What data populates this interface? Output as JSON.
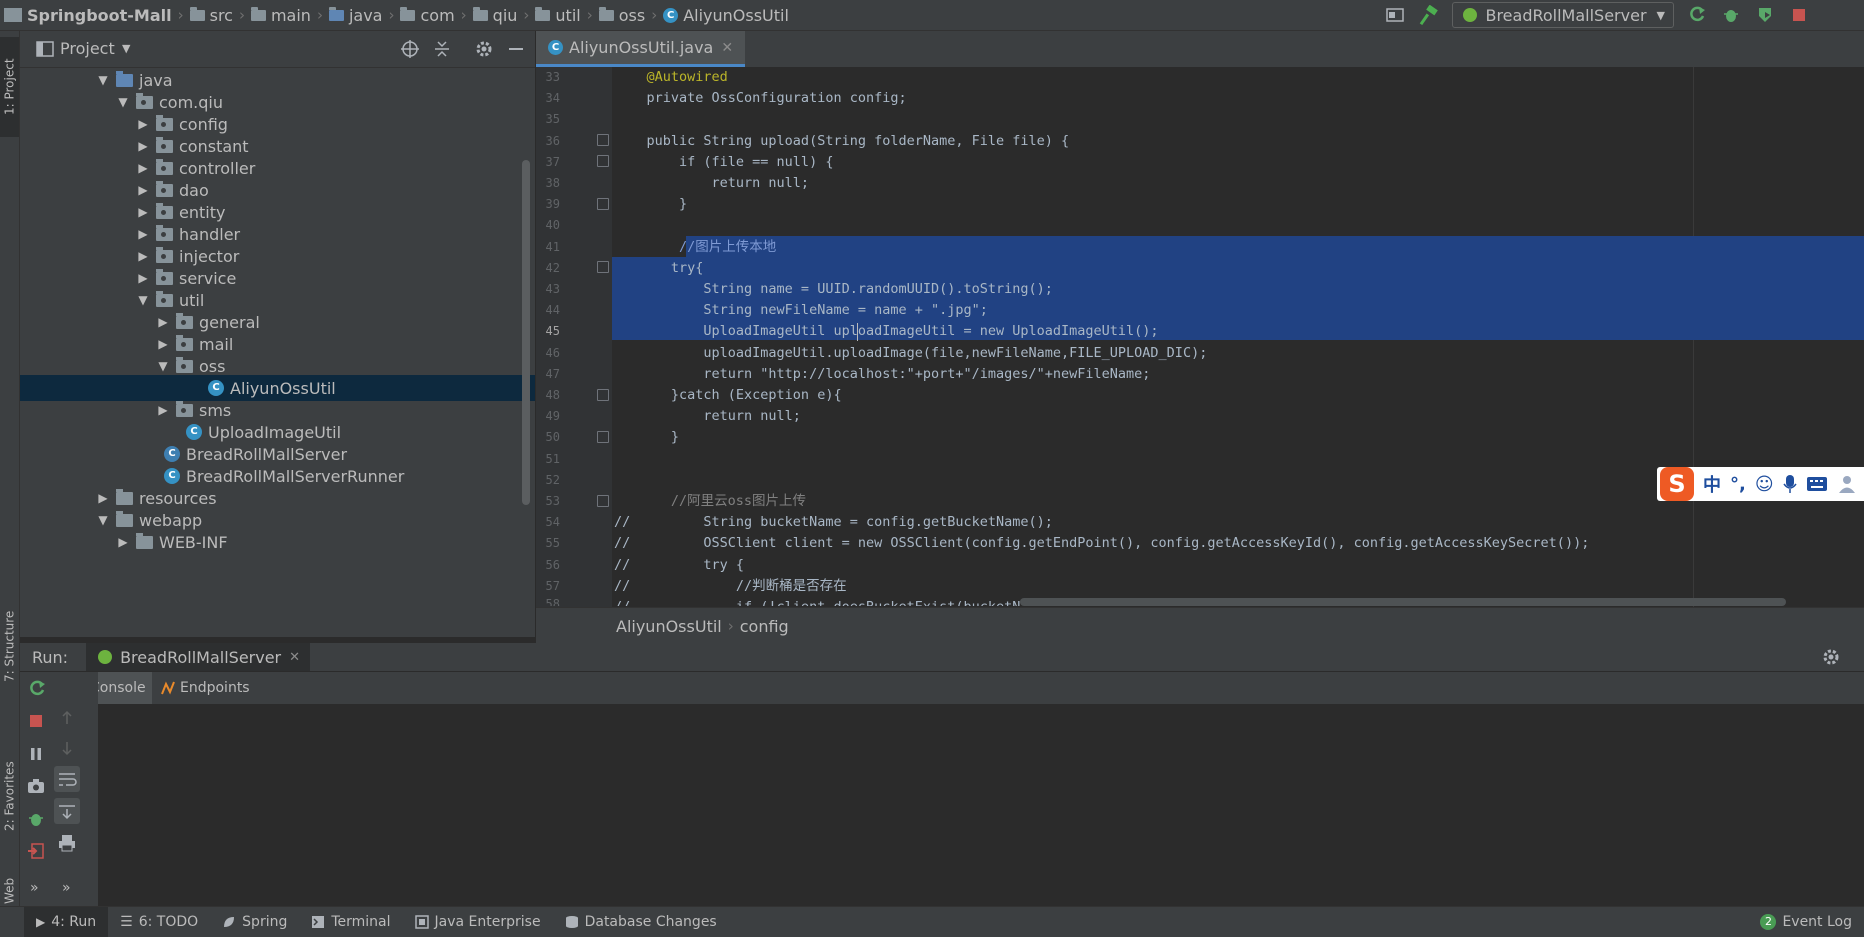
{
  "breadcrumbs": [
    "Springboot-Mall",
    "src",
    "main",
    "java",
    "com",
    "qiu",
    "util",
    "oss",
    "AliyunOssUtil"
  ],
  "run_config": "BreadRollMallServer",
  "left_strip": {
    "project": "1: Project",
    "structure": "7: Structure",
    "favorites": "2: Favorites",
    "web": "Web"
  },
  "project_panel": {
    "title": "Project"
  },
  "tree": [
    {
      "label": "java",
      "kind": "folder-blue",
      "expanded": true
    },
    {
      "label": "com.qiu",
      "kind": "package",
      "expanded": true
    },
    {
      "label": "config",
      "kind": "package",
      "expanded": false
    },
    {
      "label": "constant",
      "kind": "package",
      "expanded": false
    },
    {
      "label": "controller",
      "kind": "package",
      "expanded": false
    },
    {
      "label": "dao",
      "kind": "package",
      "expanded": false
    },
    {
      "label": "entity",
      "kind": "package",
      "expanded": false
    },
    {
      "label": "handler",
      "kind": "package",
      "expanded": false
    },
    {
      "label": "injector",
      "kind": "package",
      "expanded": false
    },
    {
      "label": "service",
      "kind": "package",
      "expanded": false
    },
    {
      "label": "util",
      "kind": "package",
      "expanded": true
    },
    {
      "label": "general",
      "kind": "package",
      "expanded": false
    },
    {
      "label": "mail",
      "kind": "package",
      "expanded": false
    },
    {
      "label": "oss",
      "kind": "package",
      "expanded": true
    },
    {
      "label": "AliyunOssUtil",
      "kind": "class",
      "selected": true
    },
    {
      "label": "sms",
      "kind": "package",
      "expanded": false
    },
    {
      "label": "UploadImageUtil",
      "kind": "class"
    },
    {
      "label": "BreadRollMallServer",
      "kind": "class"
    },
    {
      "label": "BreadRollMallServerRunner",
      "kind": "class"
    },
    {
      "label": "resources",
      "kind": "folder",
      "expanded": false
    },
    {
      "label": "webapp",
      "kind": "folder",
      "expanded": true
    },
    {
      "label": "WEB-INF",
      "kind": "folder",
      "expanded": false
    }
  ],
  "editor": {
    "tab": "AliyunOssUtil.java",
    "breadcrumb": [
      "AliyunOssUtil",
      "config"
    ],
    "lines": [
      {
        "no": "33",
        "code": "    @Autowired"
      },
      {
        "no": "34",
        "code": "    private OssConfiguration config;"
      },
      {
        "no": "35",
        "code": ""
      },
      {
        "no": "36",
        "code": "    public String upload(String folderName, File file) {"
      },
      {
        "no": "37",
        "code": "        if (file == null) {"
      },
      {
        "no": "38",
        "code": "            return null;"
      },
      {
        "no": "39",
        "code": "        }"
      },
      {
        "no": "40",
        "code": ""
      },
      {
        "no": "41",
        "code": "        //图片上传本地"
      },
      {
        "no": "42",
        "code": "       try{"
      },
      {
        "no": "43",
        "code": "           String name = UUID.randomUUID().toString();"
      },
      {
        "no": "44",
        "code": "           String newFileName = name + \".jpg\";"
      },
      {
        "no": "45",
        "code": "           UploadImageUtil uploadImageUtil = new UploadImageUtil();"
      },
      {
        "no": "46",
        "code": "           uploadImageUtil.uploadImage(file,newFileName,FILE_UPLOAD_DIC);"
      },
      {
        "no": "47",
        "code": "           return \"http://localhost:\"+port+\"/images/\"+newFileName;"
      },
      {
        "no": "48",
        "code": "       }catch (Exception e){"
      },
      {
        "no": "49",
        "code": "           return null;"
      },
      {
        "no": "50",
        "code": "       }"
      },
      {
        "no": "51",
        "code": ""
      },
      {
        "no": "52",
        "code": ""
      },
      {
        "no": "53",
        "code": "       //阿里云oss图片上传"
      },
      {
        "no": "54",
        "code": "//         String bucketName = config.getBucketName();"
      },
      {
        "no": "55",
        "code": "//         OSSClient client = new OSSClient(config.getEndPoint(), config.getAccessKeyId(), config.getAccessKeySecret());"
      },
      {
        "no": "56",
        "code": "//         try {"
      },
      {
        "no": "57",
        "code": "//             //判断桶是否存在"
      },
      {
        "no": "58",
        "code": "//             if (!client.doesBucketExist(bucketName)) {"
      }
    ]
  },
  "ime": {
    "logo": "S",
    "lang": "中",
    "punct": "°,"
  },
  "run_panel": {
    "label": "Run:",
    "config_tab": "BreadRollMallServer",
    "tabs": [
      "Console",
      "Endpoints"
    ]
  },
  "status_bar": {
    "tabs": [
      "4: Run",
      "6: TODO",
      "Spring",
      "Terminal",
      "Java Enterprise",
      "Database Changes"
    ],
    "event_log": "Event Log",
    "event_count": "2"
  },
  "colors": {
    "accent": "#4a88c7",
    "selection": "#214283",
    "tree_selection": "#0d293e",
    "keyword": "#cc7832",
    "annotation": "#bbb529",
    "string": "#6a8759",
    "comment": "#808080"
  }
}
